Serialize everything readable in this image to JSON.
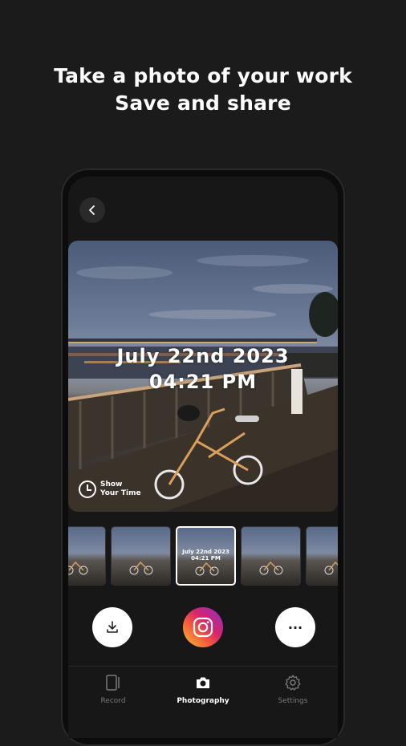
{
  "headline": {
    "line1": "Take a photo of your work",
    "line2": "Save and share"
  },
  "photo": {
    "date": "July 22nd 2023",
    "time": "04:21 PM",
    "watermark_line1": "Show",
    "watermark_line2": "Your Time"
  },
  "thumbnails": [
    {
      "label": ""
    },
    {
      "label": ""
    },
    {
      "label": "July 22nd 2023 04:21 PM",
      "selected": true
    },
    {
      "label": ""
    },
    {
      "label": ""
    }
  ],
  "actions": {
    "download_icon": "download-icon",
    "instagram_icon": "instagram-icon",
    "more_icon": "more-icon",
    "more_glyph": "···"
  },
  "tabs": {
    "record": "Record",
    "photography": "Photography",
    "settings": "Settings"
  },
  "colors": {
    "background": "#1b1b1b",
    "active_tab": "#ffffff",
    "inactive_tab": "#7a7a7a"
  }
}
